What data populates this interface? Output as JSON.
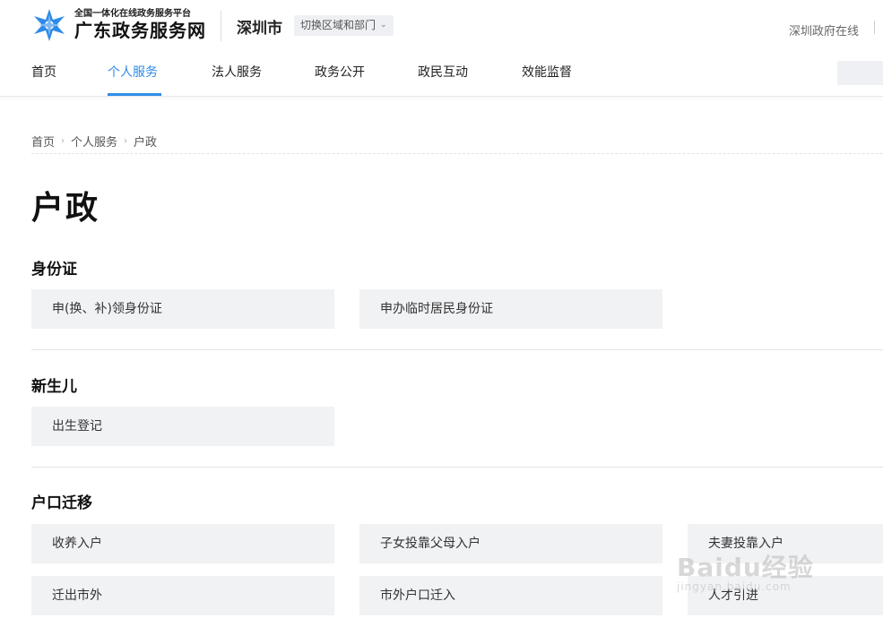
{
  "header": {
    "logo_sub": "全国一体化在线政务服务平台",
    "logo_main": "广东政务服务网",
    "city": "深圳市",
    "region_switch": "切换区域和部门",
    "top_right_link": "深圳政府在线",
    "brand_color": "#2f8be8"
  },
  "nav": [
    {
      "label": "首页"
    },
    {
      "label": "个人服务"
    },
    {
      "label": "法人服务"
    },
    {
      "label": "政务公开"
    },
    {
      "label": "政民互动"
    },
    {
      "label": "效能监督"
    }
  ],
  "breadcrumb": [
    "首页",
    "个人服务",
    "户政"
  ],
  "page_title": "户政",
  "sections": [
    {
      "title": "身份证",
      "items": [
        "申(换、补)领身份证",
        "申办临时居民身份证"
      ]
    },
    {
      "title": "新生儿",
      "items": [
        "出生登记"
      ]
    },
    {
      "title": "户口迁移",
      "items": [
        "收养入户",
        "子女投靠父母入户",
        "夫妻投靠入户",
        "迁出市外",
        "市外户口迁入",
        "人才引进"
      ]
    }
  ],
  "watermark": {
    "main": "Baidu经验",
    "sub": "jingyan.baidu.com"
  }
}
